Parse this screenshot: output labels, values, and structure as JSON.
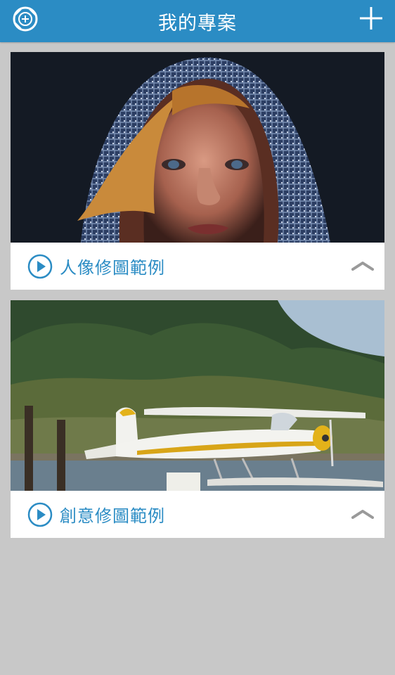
{
  "header": {
    "title": "我的專案",
    "logo_icon": "camera-aperture-plus-icon",
    "add_icon": "plus-icon"
  },
  "colors": {
    "accent": "#2b8cc4",
    "background": "#c8c8c8",
    "card": "#ffffff"
  },
  "projects": [
    {
      "label": "人像修圖範例",
      "thumbnail": "hooded-woman-portrait",
      "play_icon": "play-circle-icon",
      "toggle_icon": "chevron-up-icon"
    },
    {
      "label": "創意修圖範例",
      "thumbnail": "seaplane-on-water",
      "play_icon": "play-circle-icon",
      "toggle_icon": "chevron-up-icon"
    }
  ]
}
